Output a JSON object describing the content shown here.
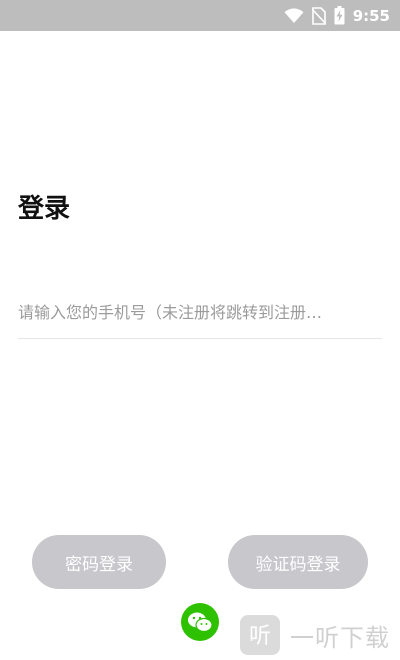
{
  "status_bar": {
    "time": "9:55",
    "icons": [
      "wifi-icon",
      "no-sim-icon",
      "battery-charging-icon"
    ]
  },
  "login": {
    "title": "登录",
    "phone_placeholder": "请输入您的手机号（未注册将跳转到注册…"
  },
  "buttons": {
    "password_login": "密码登录",
    "code_login": "验证码登录"
  },
  "third_party": {
    "icon": "wechat-icon"
  },
  "watermark": {
    "text": "一听下载",
    "logo_char": "听"
  },
  "colors": {
    "status_bar": "#bdbdbd",
    "button_bg": "#c7c7cc",
    "wechat_green": "#2dc100"
  }
}
